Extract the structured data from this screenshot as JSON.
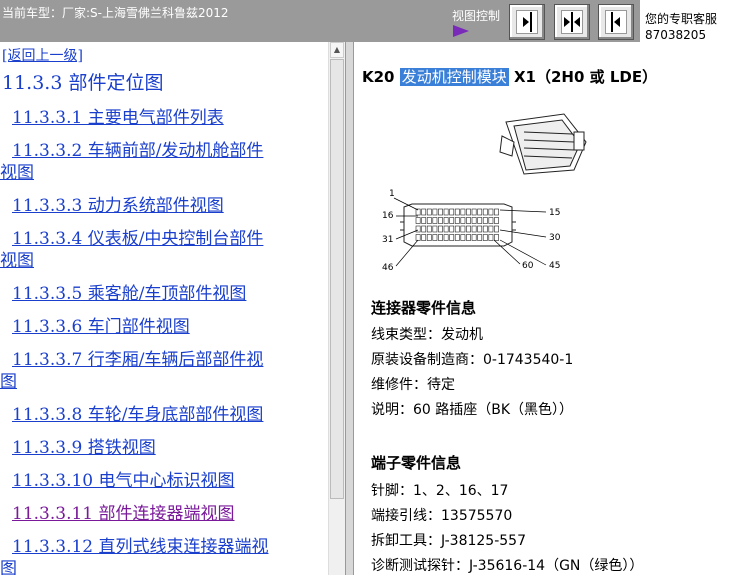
{
  "topbar": {
    "vehicle": "当前车型：厂家:S-上海雪佛兰科鲁兹2012",
    "view_control_label": "视图控制",
    "contact_line1": "您的专职客服",
    "contact_line2": "87038205"
  },
  "nav": {
    "back_link": "[返回上一级]",
    "heading": "11.3.3  部件定位图",
    "items": [
      {
        "line1": "11.3.3.1  主要电气部件列表",
        "line2": ""
      },
      {
        "line1": "11.3.3.2  车辆前部/发动机舱部件",
        "line2": "视图"
      },
      {
        "line1": "11.3.3.3  动力系统部件视图",
        "line2": ""
      },
      {
        "line1": "11.3.3.4  仪表板/中央控制台部件",
        "line2": "视图"
      },
      {
        "line1": "11.3.3.5  乘客舱/车顶部件视图",
        "line2": ""
      },
      {
        "line1": "11.3.3.6  车门部件视图",
        "line2": ""
      },
      {
        "line1": "11.3.3.7  行李厢/车辆后部部件视",
        "line2": "图"
      },
      {
        "line1": "11.3.3.8  车轮/车身底部部件视图",
        "line2": ""
      },
      {
        "line1": "11.3.3.9  搭铁视图",
        "line2": ""
      },
      {
        "line1": "11.3.3.10  电气中心标识视图",
        "line2": ""
      },
      {
        "line1": "11.3.3.11  部件连接器端视图",
        "line2": ""
      },
      {
        "line1": "11.3.3.12  直列式线束连接器端视",
        "line2": "图"
      }
    ]
  },
  "content": {
    "title_code": "K20",
    "title_highlight": "发动机控制模块",
    "title_rest": "X1（2H0 或  LDE）",
    "diagram_labels": {
      "p1": "1",
      "p15": "15",
      "p16": "16",
      "p30": "30",
      "p31": "31",
      "p45": "45",
      "p46": "46",
      "p60": "60"
    },
    "connector_section_title": "连接器零件信息",
    "connector_info": [
      "线束类型：发动机",
      "原装设备制造商：0-1743540-1",
      "维修件：待定",
      "说明：60 路插座（BK（黑色））"
    ],
    "terminal_section_title": "端子零件信息",
    "terminal_info": [
      "针脚：1、2、16、17",
      "端接引线：13575570",
      "拆卸工具：J-38125-557",
      "诊断测试探针：J-35616-14（GN（绿色））"
    ]
  }
}
